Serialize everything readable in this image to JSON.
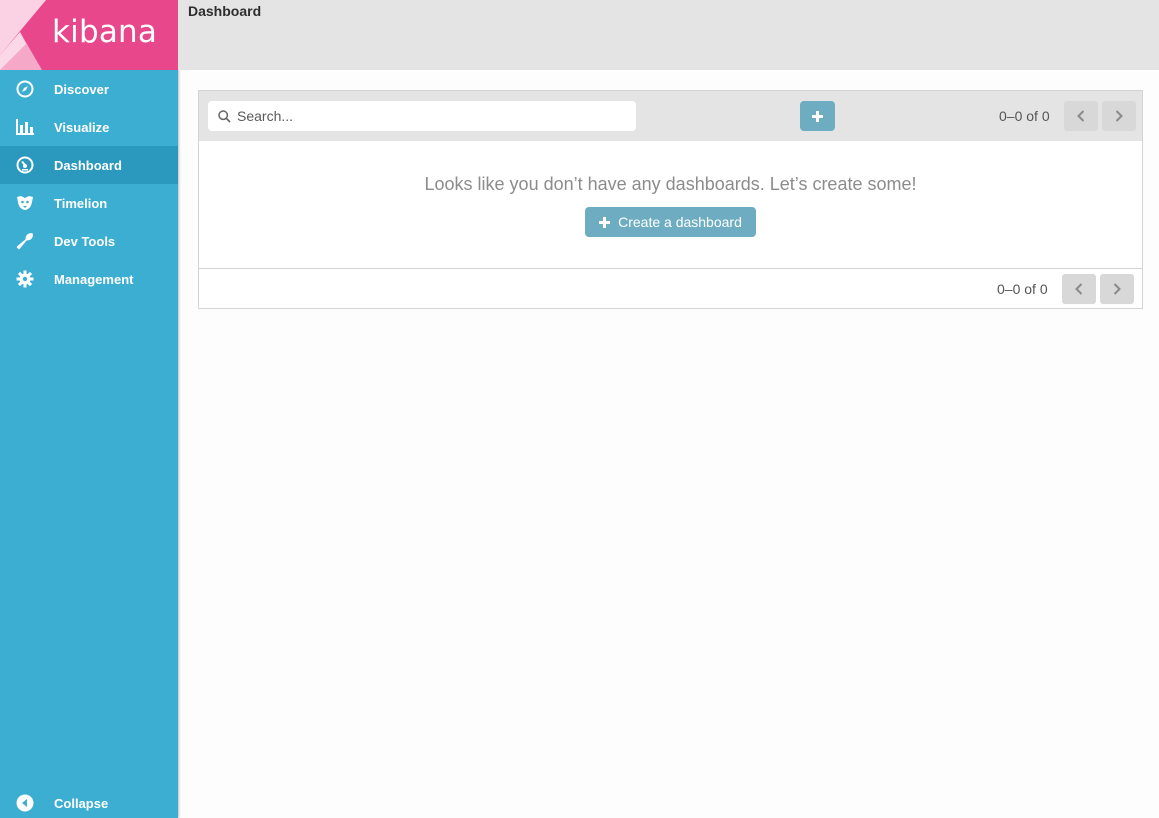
{
  "app": {
    "logo_text": "kibana",
    "brand_color": "#e8488b",
    "sidebar_color": "#3caed2"
  },
  "sidebar": {
    "items": [
      {
        "label": "Discover",
        "icon": "compass-icon"
      },
      {
        "label": "Visualize",
        "icon": "bar-chart-icon"
      },
      {
        "label": "Dashboard",
        "icon": "dashboard-gauge-icon",
        "active": true
      },
      {
        "label": "Timelion",
        "icon": "timelion-icon"
      },
      {
        "label": "Dev Tools",
        "icon": "wrench-icon"
      },
      {
        "label": "Management",
        "icon": "gear-icon"
      }
    ],
    "collapse_label": "Collapse"
  },
  "header": {
    "title": "Dashboard"
  },
  "listing": {
    "search_placeholder": "Search...",
    "pager_text_top": "0–0 of 0",
    "pager_text_bottom": "0–0 of 0",
    "empty_message": "Looks like you don’t have any dashboards. Let’s create some!",
    "create_label": "Create a dashboard"
  }
}
